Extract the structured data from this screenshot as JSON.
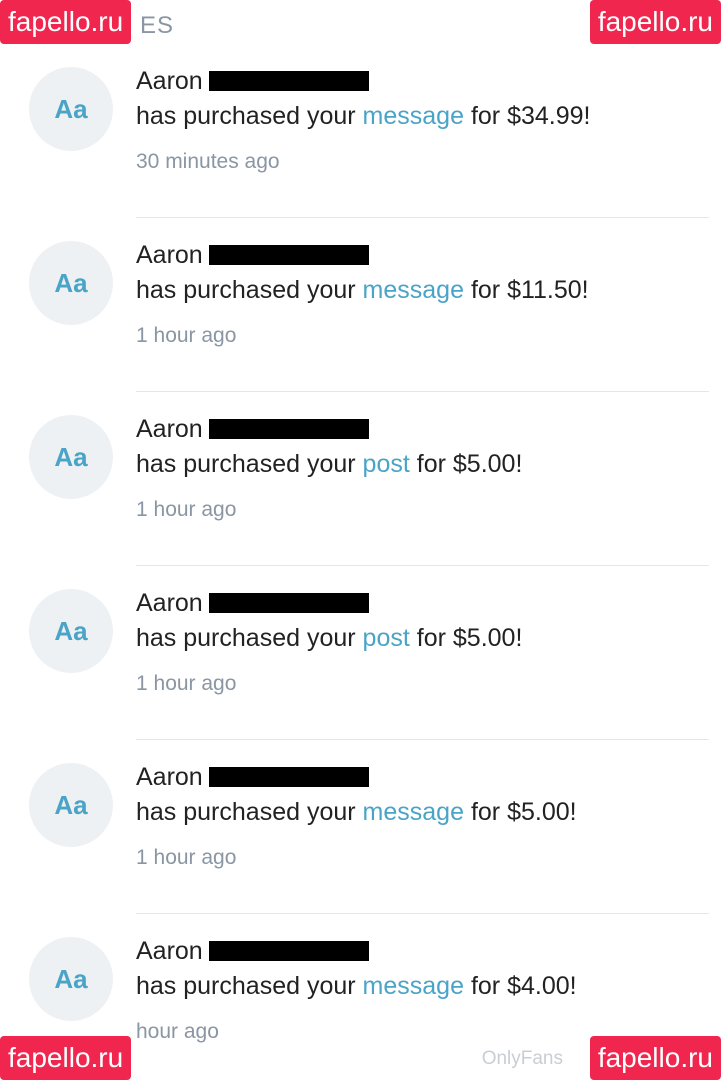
{
  "header": {
    "partial_title": "ES"
  },
  "notifications": [
    {
      "avatar": "Aa",
      "name": "Aaron",
      "prefix": "has purchased your",
      "item": "message",
      "suffix": "for $34.99!",
      "time": "30 minutes ago"
    },
    {
      "avatar": "Aa",
      "name": "Aaron",
      "prefix": "has purchased your",
      "item": "message",
      "suffix": "for $11.50!",
      "time": "1 hour ago"
    },
    {
      "avatar": "Aa",
      "name": "Aaron",
      "prefix": "has purchased your",
      "item": "post",
      "suffix": "for $5.00!",
      "time": "1 hour ago"
    },
    {
      "avatar": "Aa",
      "name": "Aaron",
      "prefix": "has purchased your",
      "item": "post",
      "suffix": "for $5.00!",
      "time": "1 hour ago"
    },
    {
      "avatar": "Aa",
      "name": "Aaron",
      "prefix": "has purchased your",
      "item": "message",
      "suffix": "for $5.00!",
      "time": "1 hour ago"
    },
    {
      "avatar": "Aa",
      "name": "Aaron",
      "prefix": "has purchased your",
      "item": "message",
      "suffix": "for $4.00!",
      "time": "hour ago"
    }
  ],
  "watermarks": {
    "top_left": "fapello.ru",
    "top_right": "fapello.ru",
    "bottom_left": "fapello.ru",
    "bottom_right": "fapello.ru",
    "footer": "OnlyFans"
  },
  "colors": {
    "link": "#4aa4c7",
    "watermark_bg": "#f0264f",
    "muted": "#8a96a3"
  }
}
